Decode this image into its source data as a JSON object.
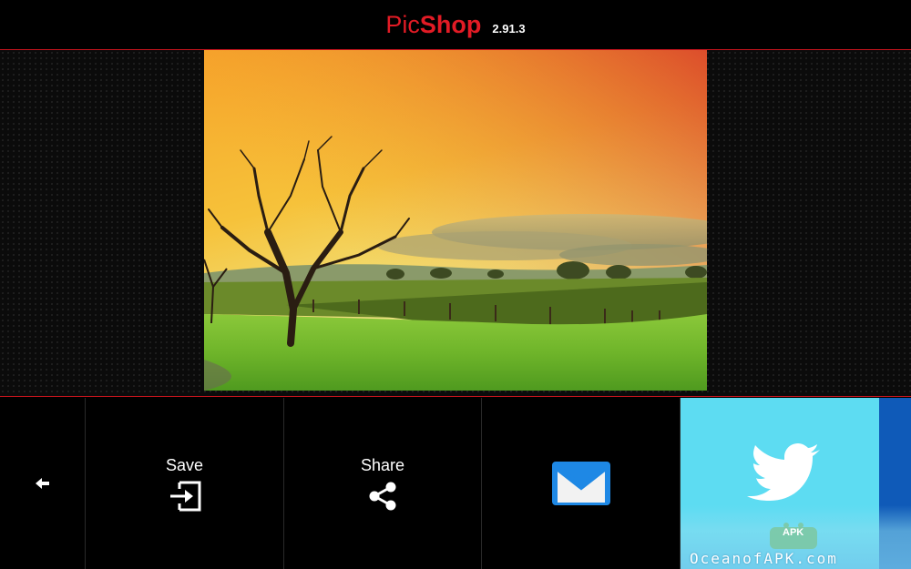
{
  "app": {
    "title_part1": "Pic",
    "title_part2": "Shop",
    "version": "2.91.3",
    "accent_color": "#e21b25"
  },
  "image": {
    "description_icon": "landscape-photo"
  },
  "bottom_bar": {
    "back": {
      "icon": "arrow-left-icon"
    },
    "save": {
      "label": "Save",
      "icon": "save-export-icon"
    },
    "share": {
      "label": "Share",
      "icon": "share-icon"
    },
    "email": {
      "icon": "gmail-icon",
      "color": "#1e88e5"
    },
    "twitter": {
      "icon": "twitter-bird-icon",
      "color": "#5ddcf2"
    }
  },
  "watermark": {
    "text": "OceanofAPK.com",
    "badge": "APK"
  }
}
